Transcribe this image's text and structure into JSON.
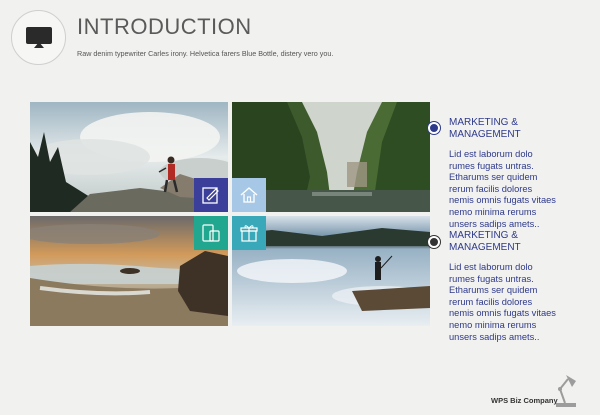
{
  "header": {
    "icon": "monitor-icon",
    "title": "INTRODUCTION",
    "subtitle": "Raw denim typewriter Carles irony. Helvetica farers Blue Bottle, distery vero you."
  },
  "tiles": [
    {
      "icon": "edit-icon",
      "color": "#3b3f9a"
    },
    {
      "icon": "home-icon",
      "color": "#a6c8e6"
    },
    {
      "icon": "devices-icon",
      "color": "#21a78f"
    },
    {
      "icon": "gift-icon",
      "color": "#39a8b8"
    }
  ],
  "sections": [
    {
      "heading_line1": "MARKETING &",
      "heading_line2": "MANAGEMENT",
      "body": "Lid est laborum dolo rumes fugats untras. Etharums ser quidem rerum facilis dolores nemis omnis fugats vitaes nemo minima rerums unsers sadips amets.."
    },
    {
      "heading_line1": "MARKETING &",
      "heading_line2": "MANAGEMENT",
      "body": "Lid est laborum dolo rumes fugats untras. Etharums ser quidem rerum facilis dolores nemis omnis fugats vitaes nemo minima rerums unsers sadips amets.."
    }
  ],
  "footer": {
    "brand": "WPS Biz Company",
    "icon": "desk-lamp-icon"
  }
}
